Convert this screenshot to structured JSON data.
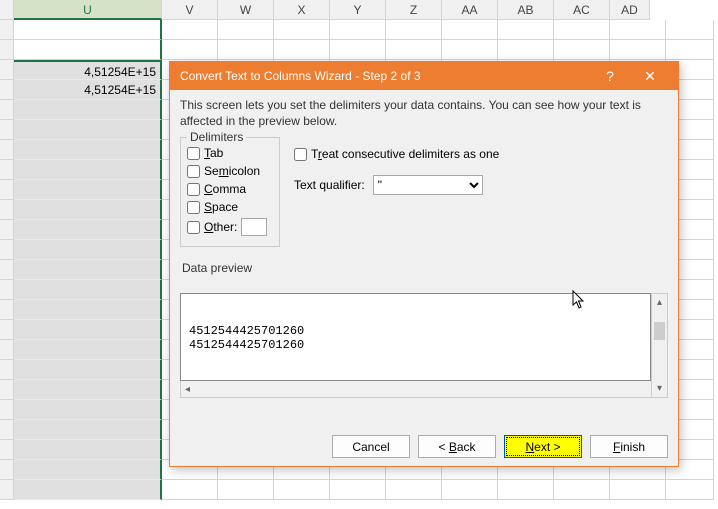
{
  "columns": {
    "u": "U",
    "v": "V",
    "w": "W",
    "x": "X",
    "y": "Y",
    "z": "Z",
    "aa": "AA",
    "ab": "AB",
    "ac": "AC",
    "ad": "AD"
  },
  "cells": {
    "u_row3": "4,51254E+15",
    "u_row4": "4,51254E+15"
  },
  "dialog": {
    "title": "Convert Text to Columns Wizard - Step 2 of 3",
    "help": "?",
    "close": "✕",
    "desc": "This screen lets you set the delimiters your data contains.  You can see how your text is affected in the preview below.",
    "delimiters_legend": "Delimiters",
    "tab": "Tab",
    "semicolon": "Semicolon",
    "comma": "Comma",
    "space": "Space",
    "other": "Other:",
    "treat_consec": "Treat consecutive delimiters as one",
    "text_qualifier_label": "Text qualifier:",
    "text_qualifier_value": "\"",
    "data_preview_label": "Data preview",
    "preview_line1": "4512544425701260",
    "preview_line2": "4512544425701260"
  },
  "buttons": {
    "cancel": "Cancel",
    "back": "< Back",
    "next": "Next >",
    "finish": "Finish"
  }
}
